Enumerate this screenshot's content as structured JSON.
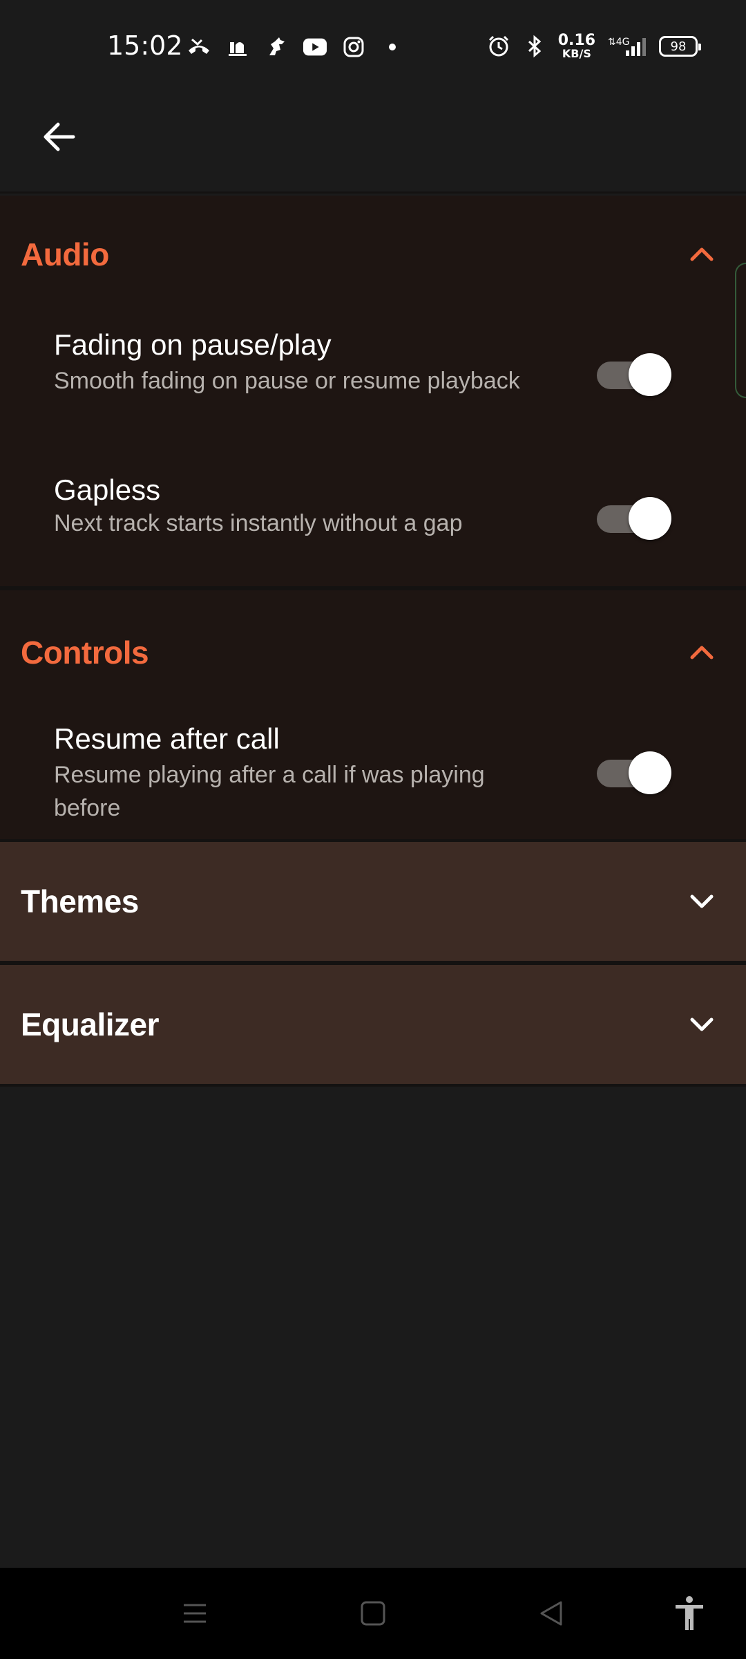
{
  "status_bar": {
    "time": "15:02",
    "left_icons": [
      "missed-call-icon",
      "news-icon",
      "horse-app-icon",
      "youtube-icon",
      "instagram-icon",
      "dot-icon"
    ],
    "right_icons": [
      "alarm-icon",
      "bluetooth-icon",
      "signal-icon"
    ],
    "net_speed_value": "0.16",
    "net_speed_unit": "KB/S",
    "network": "4G",
    "battery": "98"
  },
  "app_bar": {
    "back_icon": "arrow-back-icon"
  },
  "sections": {
    "audio": {
      "title": "Audio",
      "expanded": true,
      "items": [
        {
          "title": "Fading on pause/play",
          "subtitle": "Smooth fading on pause or resume playback",
          "enabled": true
        },
        {
          "title": "Gapless",
          "subtitle": "Next track starts instantly without a gap",
          "enabled": true
        }
      ]
    },
    "controls": {
      "title": "Controls",
      "expanded": true,
      "items": [
        {
          "title": "Resume after call",
          "subtitle": "Resume playing after a call if was playing before",
          "enabled": true
        }
      ]
    },
    "themes": {
      "title": "Themes",
      "expanded": false
    },
    "equalizer": {
      "title": "Equalizer",
      "expanded": false
    }
  },
  "nav_bar": {
    "icons": [
      "menu-icon",
      "home-icon",
      "back-triangle-icon",
      "accessibility-icon"
    ]
  },
  "colors": {
    "accent": "#f36a3e",
    "expanded_bg": "#1e1512",
    "collapsed_bg": "#3d2b24",
    "page_bg": "#1b1b1b"
  }
}
